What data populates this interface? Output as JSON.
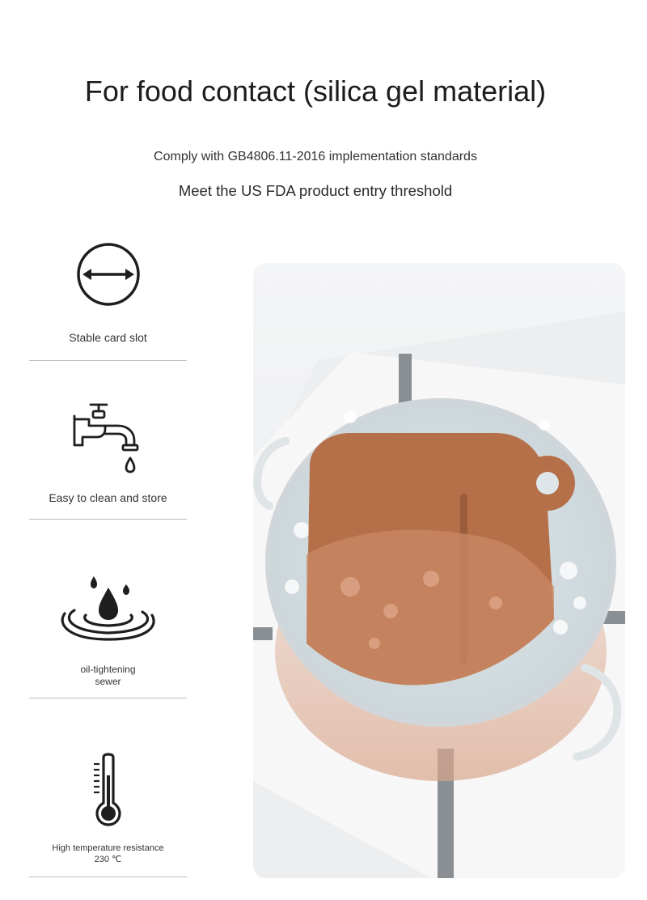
{
  "header": {
    "title": "For food contact (silica gel material)",
    "subtitle_1": "Comply with GB4806.11-2016 implementation standards",
    "subtitle_2": "Meet the US FDA product entry threshold"
  },
  "features": [
    {
      "icon": "double-arrow-circle-icon",
      "label": "Stable card slot"
    },
    {
      "icon": "faucet-icon",
      "label": "Easy to clean and store"
    },
    {
      "icon": "water-drop-ripple-icon",
      "label_line1": "oil-tightening",
      "label_line2": "sewer"
    },
    {
      "icon": "thermometer-icon",
      "label_line1": "High temperature resistance",
      "label_line2": "230 ℃"
    }
  ],
  "colors": {
    "silicone_brown": "#b5704a",
    "icon_dark": "#1e1e1e",
    "divider": "#bdbdbd"
  }
}
